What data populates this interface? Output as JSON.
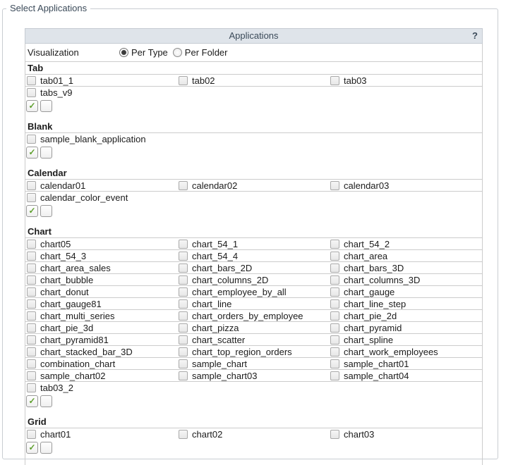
{
  "fieldset": {
    "legend": "Select Applications"
  },
  "header": {
    "title": "Applications",
    "help": "?"
  },
  "visualization": {
    "label": "Visualization",
    "options": [
      {
        "label": "Per Type",
        "selected": true
      },
      {
        "label": "Per Folder",
        "selected": false
      }
    ]
  },
  "sections": [
    {
      "title": "Tab",
      "apps": [
        "tab01_1",
        "tab02",
        "tab03",
        "tabs_v9"
      ]
    },
    {
      "title": "Blank",
      "apps": [
        "sample_blank_application"
      ]
    },
    {
      "title": "Calendar",
      "apps": [
        "calendar01",
        "calendar02",
        "calendar03",
        "calendar_color_event"
      ]
    },
    {
      "title": "Chart",
      "apps": [
        "chart05",
        "chart_54_1",
        "chart_54_2",
        "chart_54_3",
        "chart_54_4",
        "chart_area",
        "chart_area_sales",
        "chart_bars_2D",
        "chart_bars_3D",
        "chart_bubble",
        "chart_columns_2D",
        "chart_columns_3D",
        "chart_donut",
        "chart_employee_by_all",
        "chart_gauge",
        "chart_gauge81",
        "chart_line",
        "chart_line_step",
        "chart_multi_series",
        "chart_orders_by_employee",
        "chart_pie_2d",
        "chart_pie_3d",
        "chart_pizza",
        "chart_pyramid",
        "chart_pyramid81",
        "chart_scatter",
        "chart_spline",
        "chart_stacked_bar_3D",
        "chart_top_region_orders",
        "chart_work_employees",
        "combination_chart",
        "sample_chart",
        "sample_chart01",
        "sample_chart02",
        "sample_chart03",
        "sample_chart04",
        "tab03_2"
      ]
    },
    {
      "title": "Grid",
      "apps": [
        "chart01",
        "chart02",
        "chart03"
      ]
    }
  ],
  "icons": {
    "check_glyph": "✓"
  },
  "colors": {
    "header_bg": "#dfe4ea",
    "header_text": "#3b4a59",
    "legend_text": "#3b4a59",
    "row_border": "#cccccc",
    "check_green": "#5e9f2d"
  }
}
